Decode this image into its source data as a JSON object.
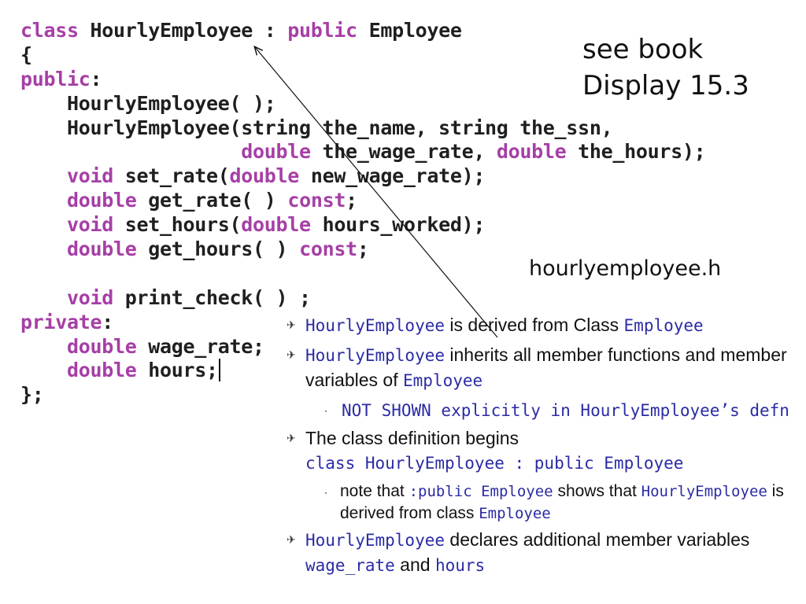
{
  "code": {
    "lines": [
      [
        {
          "t": "class",
          "k": true
        },
        {
          "t": " HourlyEmployee : "
        },
        {
          "t": "public",
          "k": true
        },
        {
          "t": " Employee"
        }
      ],
      [
        {
          "t": "{"
        }
      ],
      [
        {
          "t": "public",
          "k": true
        },
        {
          "t": ":"
        }
      ],
      [
        {
          "t": "    HourlyEmployee( );"
        }
      ],
      [
        {
          "t": "    HourlyEmployee(string the_name, string the_ssn,"
        }
      ],
      [
        {
          "t": "                   "
        },
        {
          "t": "double",
          "k": true
        },
        {
          "t": " the_wage_rate, "
        },
        {
          "t": "double",
          "k": true
        },
        {
          "t": " the_hours);"
        }
      ],
      [
        {
          "t": "    "
        },
        {
          "t": "void",
          "k": true
        },
        {
          "t": " set_rate("
        },
        {
          "t": "double",
          "k": true
        },
        {
          "t": " new_wage_rate);"
        }
      ],
      [
        {
          "t": "    "
        },
        {
          "t": "double",
          "k": true
        },
        {
          "t": " get_rate( ) "
        },
        {
          "t": "const",
          "k": true
        },
        {
          "t": ";"
        }
      ],
      [
        {
          "t": "    "
        },
        {
          "t": "void",
          "k": true
        },
        {
          "t": " set_hours("
        },
        {
          "t": "double",
          "k": true
        },
        {
          "t": " hours_worked);"
        }
      ],
      [
        {
          "t": "    "
        },
        {
          "t": "double",
          "k": true
        },
        {
          "t": " get_hours( ) "
        },
        {
          "t": "const",
          "k": true
        },
        {
          "t": ";"
        }
      ],
      [
        {
          "t": ""
        }
      ],
      [
        {
          "t": "    "
        },
        {
          "t": "void",
          "k": true
        },
        {
          "t": " print_check( ) ;"
        }
      ],
      [
        {
          "t": "private",
          "k": true
        },
        {
          "t": ":"
        }
      ],
      [
        {
          "t": "    "
        },
        {
          "t": "double",
          "k": true
        },
        {
          "t": " wage_rate;"
        }
      ],
      [
        {
          "t": "    "
        },
        {
          "t": "double",
          "k": true
        },
        {
          "t": " hours;"
        },
        {
          "t": "",
          "cursor": true
        }
      ],
      [
        {
          "t": "};"
        }
      ]
    ]
  },
  "note": {
    "line1": "see book",
    "line2": "Display 15.3"
  },
  "filename": "hourlyemployee.h",
  "bullet_marker": "✈",
  "sub_marker": "˖",
  "bullets": [
    {
      "level": 1,
      "parts": [
        {
          "t": "HourlyEmployee",
          "c": true
        },
        {
          "t": " is derived from Class "
        },
        {
          "t": "Employee",
          "c": true
        }
      ]
    },
    {
      "level": 1,
      "parts": [
        {
          "t": "HourlyEmployee",
          "c": true
        },
        {
          "t": " inherits all member functions and member variables of "
        },
        {
          "t": "Employee",
          "c": true
        }
      ]
    },
    {
      "level": 2,
      "parts": [
        {
          "t": "NOT SHOWN explicitly in HourlyEmployee’s defn",
          "c": true
        }
      ]
    },
    {
      "level": 1,
      "parts": [
        {
          "t": "The class definition begins "
        },
        {
          "t": "class HourlyEmployee : public Employee",
          "c": true,
          "block": true
        }
      ]
    },
    {
      "level": 2,
      "small": true,
      "parts": [
        {
          "t": "note that "
        },
        {
          "t": ":public Employee",
          "c": true
        },
        {
          "t": " shows that "
        },
        {
          "t": "HourlyEmployee",
          "c": true
        },
        {
          "t": " is derived from class "
        },
        {
          "t": "Employee",
          "c": true
        }
      ]
    },
    {
      "level": 1,
      "parts": [
        {
          "t": "HourlyEmployee",
          "c": true
        },
        {
          "t": " declares additional member variables "
        },
        {
          "t": "wage_rate",
          "c": true
        },
        {
          "t": " and "
        },
        {
          "t": "hours",
          "c": true
        }
      ]
    }
  ],
  "colors": {
    "keyword": "#a63fa6",
    "code_text": "#1f1f1f",
    "inline_code": "#2b2ba5"
  }
}
